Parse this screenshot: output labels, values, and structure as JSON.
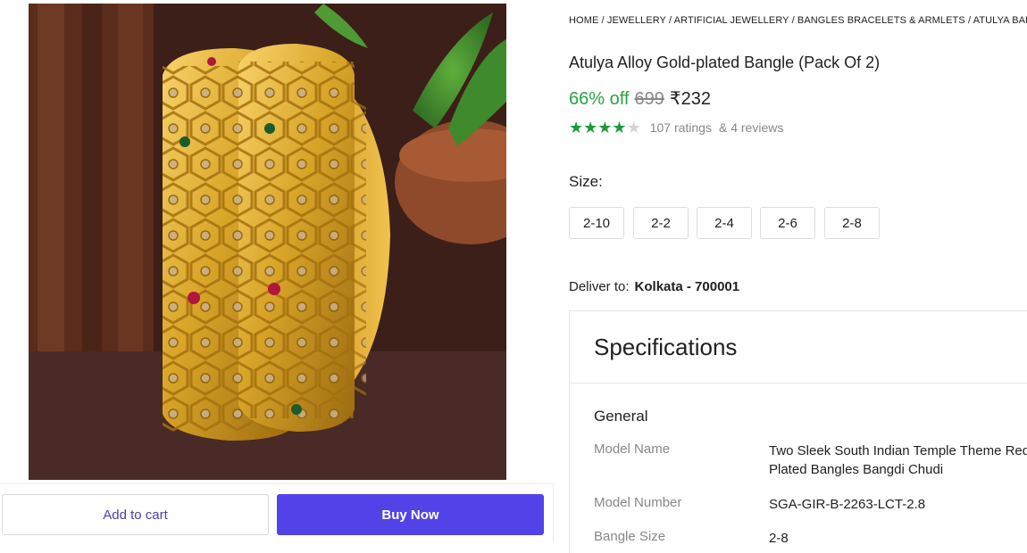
{
  "breadcrumb": [
    "HOME",
    "JEWELLERY",
    "ARTIFICIAL JEWELLERY",
    "BANGLES BRACELETS & ARMLETS",
    "ATULYA BANGLES"
  ],
  "breadcrumb_separator": " / ",
  "product": {
    "title": "Atulya Alloy Gold-plated Bangle (Pack Of 2)",
    "discount": "66% off",
    "mrp": "699",
    "price": "₹232",
    "rating_value": 4,
    "rating_max": 5,
    "ratings_count": "107 ratings",
    "reviews_count": "& 4 reviews"
  },
  "size": {
    "label": "Size:",
    "options": [
      "2-10",
      "2-2",
      "2-4",
      "2-6",
      "2-8"
    ]
  },
  "delivery": {
    "label": "Deliver to:",
    "location": "Kolkata - 700001"
  },
  "actions": {
    "add_to_cart": "Add to cart",
    "buy_now": "Buy Now"
  },
  "specifications": {
    "title": "Specifications",
    "section": "General",
    "rows": [
      {
        "key": "Model Name",
        "value": "Two Sleek South Indian Temple Theme Red Plated Bangles Bangdi Chudi"
      },
      {
        "key": "Model Number",
        "value": "SGA-GIR-B-2263-LCT-2.8"
      },
      {
        "key": "Bangle Size",
        "value": "2-8"
      }
    ]
  },
  "colors": {
    "discount_green": "#26a541",
    "star_green": "#1c9a3a",
    "buy_now_bg": "#5243e8",
    "add_to_cart_text": "#4b3fb0"
  },
  "icons": {
    "star": "star-icon",
    "rupee": "rupee-icon"
  }
}
